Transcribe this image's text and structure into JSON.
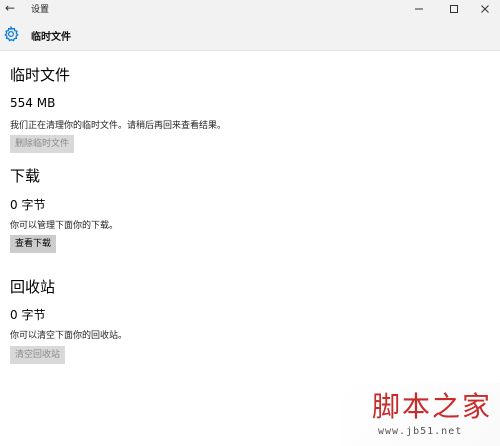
{
  "window": {
    "app_title": "设置",
    "back_glyph": "←",
    "controls": [
      "minimize-icon",
      "maximize-icon",
      "close-icon"
    ]
  },
  "header": {
    "icon": "gear-icon",
    "title": "临时文件",
    "accent_color": "#0078d7"
  },
  "sections": {
    "temp": {
      "title": "临时文件",
      "size": "554 MB",
      "description": "我们正在清理你的临时文件。请稍后再回来查看结果。",
      "button_label": "删除临时文件",
      "button_enabled": false
    },
    "downloads": {
      "title": "下载",
      "size": "0 字节",
      "description": "你可以管理下面你的下载。",
      "button_label": "查看下载",
      "button_enabled": true
    },
    "recycle": {
      "title": "回收站",
      "size": "0 字节",
      "description": "你可以清空下面你的回收站。",
      "button_label": "清空回收站",
      "button_enabled": false
    }
  },
  "watermark": {
    "main": "脚本之家",
    "url": "www.jb51.net",
    "color": "#c92a2a"
  }
}
